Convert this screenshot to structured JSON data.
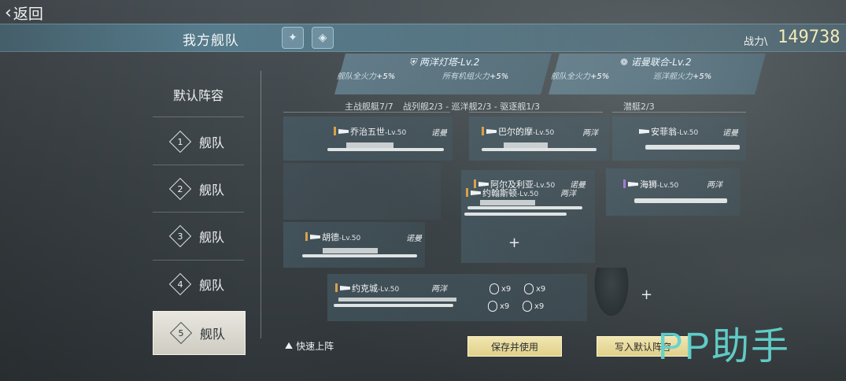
{
  "nav": {
    "back_label": "返回"
  },
  "header": {
    "title": "我方舰队",
    "power_label": "战力",
    "power_value": "149738"
  },
  "sidebar": {
    "items": [
      {
        "label": "默认阵容"
      },
      {
        "number": "1",
        "label": "舰队"
      },
      {
        "number": "2",
        "label": "舰队"
      },
      {
        "number": "3",
        "label": "舰队"
      },
      {
        "number": "4",
        "label": "舰队"
      },
      {
        "number": "5",
        "label": "舰队",
        "active": true
      }
    ]
  },
  "buffs": [
    {
      "name": "两洋灯塔-Lv.2",
      "effect_left": "舰队全火力",
      "effect_left_val": "+5%",
      "effect_right": "所有机组火力",
      "effect_right_val": "+5%"
    },
    {
      "name": "诺曼联合-Lv.2",
      "effect_left": "舰队全火力",
      "effect_left_val": "+5%",
      "effect_right": "巡洋舰火力",
      "effect_right_val": "+5%"
    }
  ],
  "categories": {
    "main": "主战舰艇7/7",
    "detail": "战列舰2/3 - 巡洋舰2/3 - 驱逐舰1/3",
    "sub": "潜艇2/3"
  },
  "ships": {
    "battleship_1": {
      "name": "乔治五世",
      "level": "-Lv.50",
      "faction": "诺曼"
    },
    "battleship_2": {
      "name": "胡德",
      "level": "-Lv.50",
      "faction": "诺曼"
    },
    "cruiser_1": {
      "name": "巴尔的摩",
      "level": "-Lv.50",
      "faction": "两洋"
    },
    "cruiser_2": {
      "name": "阿尔及利亚",
      "level": "-Lv.50",
      "faction": "诺曼"
    },
    "destroyer_1": {
      "name": "约翰斯顿",
      "level": "-Lv.50",
      "faction": "两洋"
    },
    "sub_1": {
      "name": "安菲翁",
      "level": "-Lv.50",
      "faction": "诺曼"
    },
    "sub_2": {
      "name": "海狮",
      "level": "-Lv.50",
      "faction": "两洋"
    },
    "carrier": {
      "name": "约克城",
      "level": "-Lv.50",
      "faction": "两洋"
    }
  },
  "aircraft": [
    {
      "count": "x9"
    },
    {
      "count": "x9"
    },
    {
      "count": "x9"
    },
    {
      "count": "x9"
    }
  ],
  "actions": {
    "quick_deploy": "快速上阵",
    "save_use": "保存并使用",
    "write_default": "写入默认阵容"
  },
  "watermark": "PP助手",
  "colors": {
    "accent": "#f3e9b8",
    "button": "#e8dc9c",
    "watermark": "#63d3cf"
  }
}
